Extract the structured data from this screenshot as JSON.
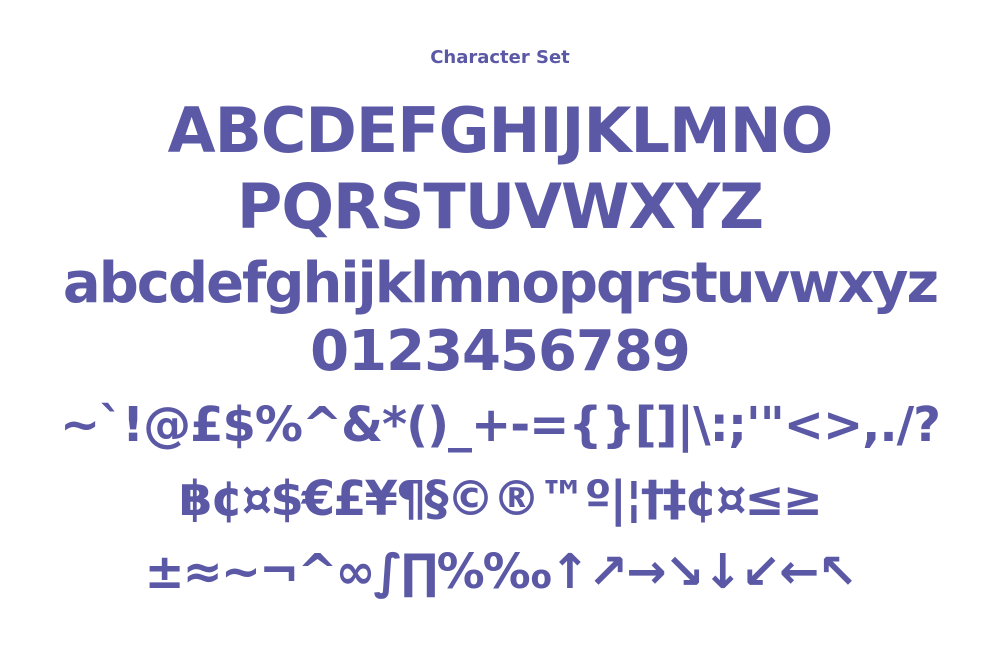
{
  "accent_color": "#5b59a6",
  "background_color": "#ffffff",
  "title": "Character Set",
  "lines": [
    "ABCDEFGHIJKLMNO",
    "PQRSTUVWXYZ",
    "abcdefghijklmnopqrstuvwxyz",
    "0123456789",
    "~`!@£$%^&*()_+-={}[]|\\:;'\"<>,./?",
    "฿¢¤$€£¥¶§©®™º|¦†‡¢¤≤≥",
    "±≈~¬^∞∫∏%‰↑↗→↘↓↙←↖"
  ]
}
